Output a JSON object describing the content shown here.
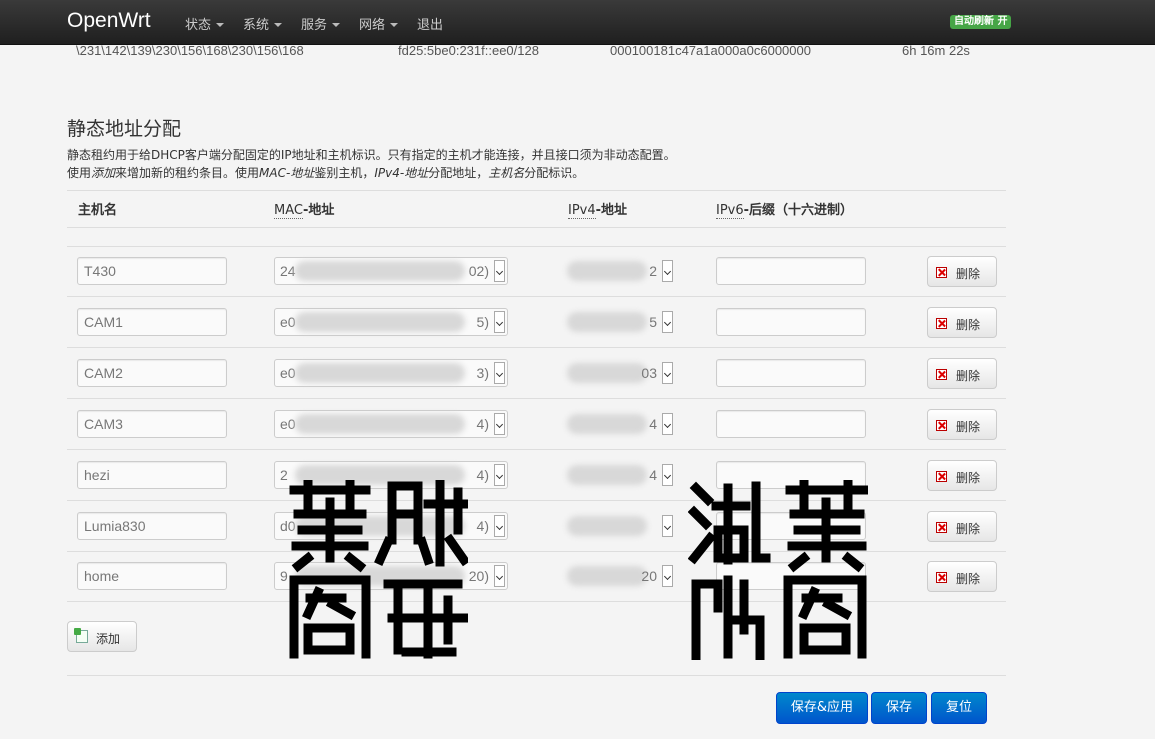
{
  "nav": {
    "brand": "OpenWrt",
    "menu": [
      {
        "label": "状态",
        "dropdown": true
      },
      {
        "label": "系统",
        "dropdown": true
      },
      {
        "label": "服务",
        "dropdown": true
      },
      {
        "label": "网络",
        "dropdown": true
      },
      {
        "label": "退出",
        "dropdown": false
      }
    ],
    "auto_refresh": "自动刷新 开"
  },
  "active_lease": {
    "hostname": "\\231\\142\\139\\230\\156\\168\\230\\156\\168",
    "ipv6": "fd25:5be0:231f::ee0/128",
    "duid": "000100181c47a1a000a0c6000000",
    "remaining": "6h 16m 22s"
  },
  "section": {
    "title": "静态地址分配",
    "desc_line1": "静态租约用于给DHCP客户端分配固定的IP地址和主机标识。只有指定的主机才能连接，并且接口须为非动态配置。",
    "desc_line2": {
      "p1": "使用",
      "add_em": "添加",
      "p2": "来增加新的租约条目。使用",
      "mac_em": "MAC-地址",
      "p3": "鉴别主机，",
      "ipv4_em": "IPv4-地址",
      "p4": "分配地址，",
      "host_em": "主机名",
      "p5": "分配标识。"
    }
  },
  "table": {
    "headers": {
      "hostname": "主机名",
      "mac_abbr": "MAC",
      "mac_rest": "-地址",
      "ipv4_abbr": "IPv4",
      "ipv4_rest": "-地址",
      "ipv6_abbr": "IPv6",
      "ipv6_rest": "-后缀（十六进制）"
    },
    "rows": [
      {
        "hostname": "T430",
        "mac_start": "24",
        "mac_end": "02)",
        "ip_end": "2"
      },
      {
        "hostname": "CAM1",
        "mac_start": "e0",
        "mac_end": "5)",
        "ip_end": "5"
      },
      {
        "hostname": "CAM2",
        "mac_start": "e0",
        "mac_end": "3)",
        "ip_end": "03"
      },
      {
        "hostname": "CAM3",
        "mac_start": "e0",
        "mac_end": "4)",
        "ip_end": "4"
      },
      {
        "hostname": "hezi",
        "mac_start": "2",
        "mac_end": "4)",
        "ip_end": "4"
      },
      {
        "hostname": "Lumia830",
        "mac_start": "d0",
        "mac_end": "4)",
        "ip_end": ""
      },
      {
        "hostname": "home",
        "mac_start": "9",
        "mac_end": "20)",
        "ip_end": "20"
      }
    ],
    "delete_label": "删除"
  },
  "add_label": "添加",
  "buttons": {
    "save_apply": "保存&应用",
    "save": "保存",
    "reset": "复位"
  },
  "seals": [
    {
      "name": "seal-left",
      "chars": [
        "蕤",
        "賊",
        "阁",
        "印"
      ]
    },
    {
      "name": "seal-right",
      "chars": [
        "湖",
        "蕤",
        "印",
        "阁"
      ]
    }
  ],
  "colors": {
    "accent": "#0069d6",
    "badge": "#46a546",
    "navbar": "#2a2a2a"
  }
}
